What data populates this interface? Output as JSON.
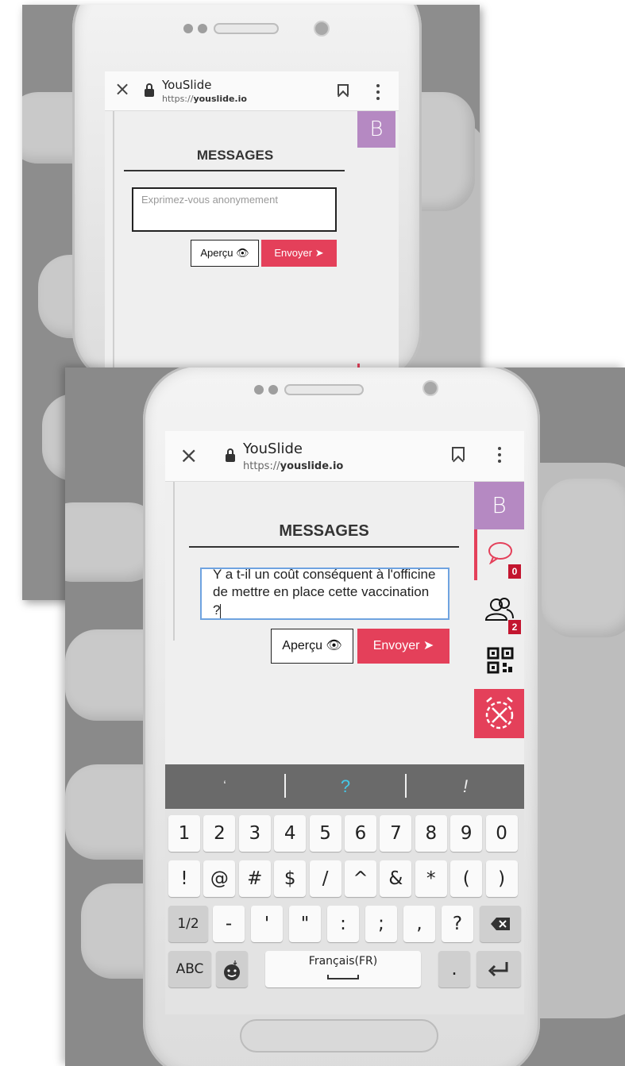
{
  "browser": {
    "site_title": "YouSlide",
    "url_prefix": "https://",
    "url_domain": "youslide.io"
  },
  "page": {
    "avatar_letter": "B",
    "heading": "MESSAGES",
    "placeholder": "Exprimez-vous anonymement",
    "typed_message": "Y a t-il un coût conséquent à l'officine de mettre en place cette vaccination ?",
    "preview_label": "Aperçu",
    "send_label": "Envoyer"
  },
  "sidebar": {
    "messages_count": "0",
    "participants_count": "2"
  },
  "keyboard": {
    "suggestions": [
      "ʻ",
      "?",
      "!"
    ],
    "row_numbers": [
      "1",
      "2",
      "3",
      "4",
      "5",
      "6",
      "7",
      "8",
      "9",
      "0"
    ],
    "row_symbols": [
      "!",
      "@",
      "#",
      "$",
      "/",
      "^",
      "&",
      "*",
      "(",
      ")"
    ],
    "row_punct": [
      "1/2",
      "-",
      "'",
      "\"",
      ":",
      ";",
      ",",
      "?"
    ],
    "abc_label": "ABC",
    "space_label": "Français(FR)",
    "period_label": "."
  },
  "colors": {
    "accent": "#e4405a",
    "avatar": "#b589c2",
    "badge": "#c3152f",
    "focus": "#6fa3e0"
  }
}
